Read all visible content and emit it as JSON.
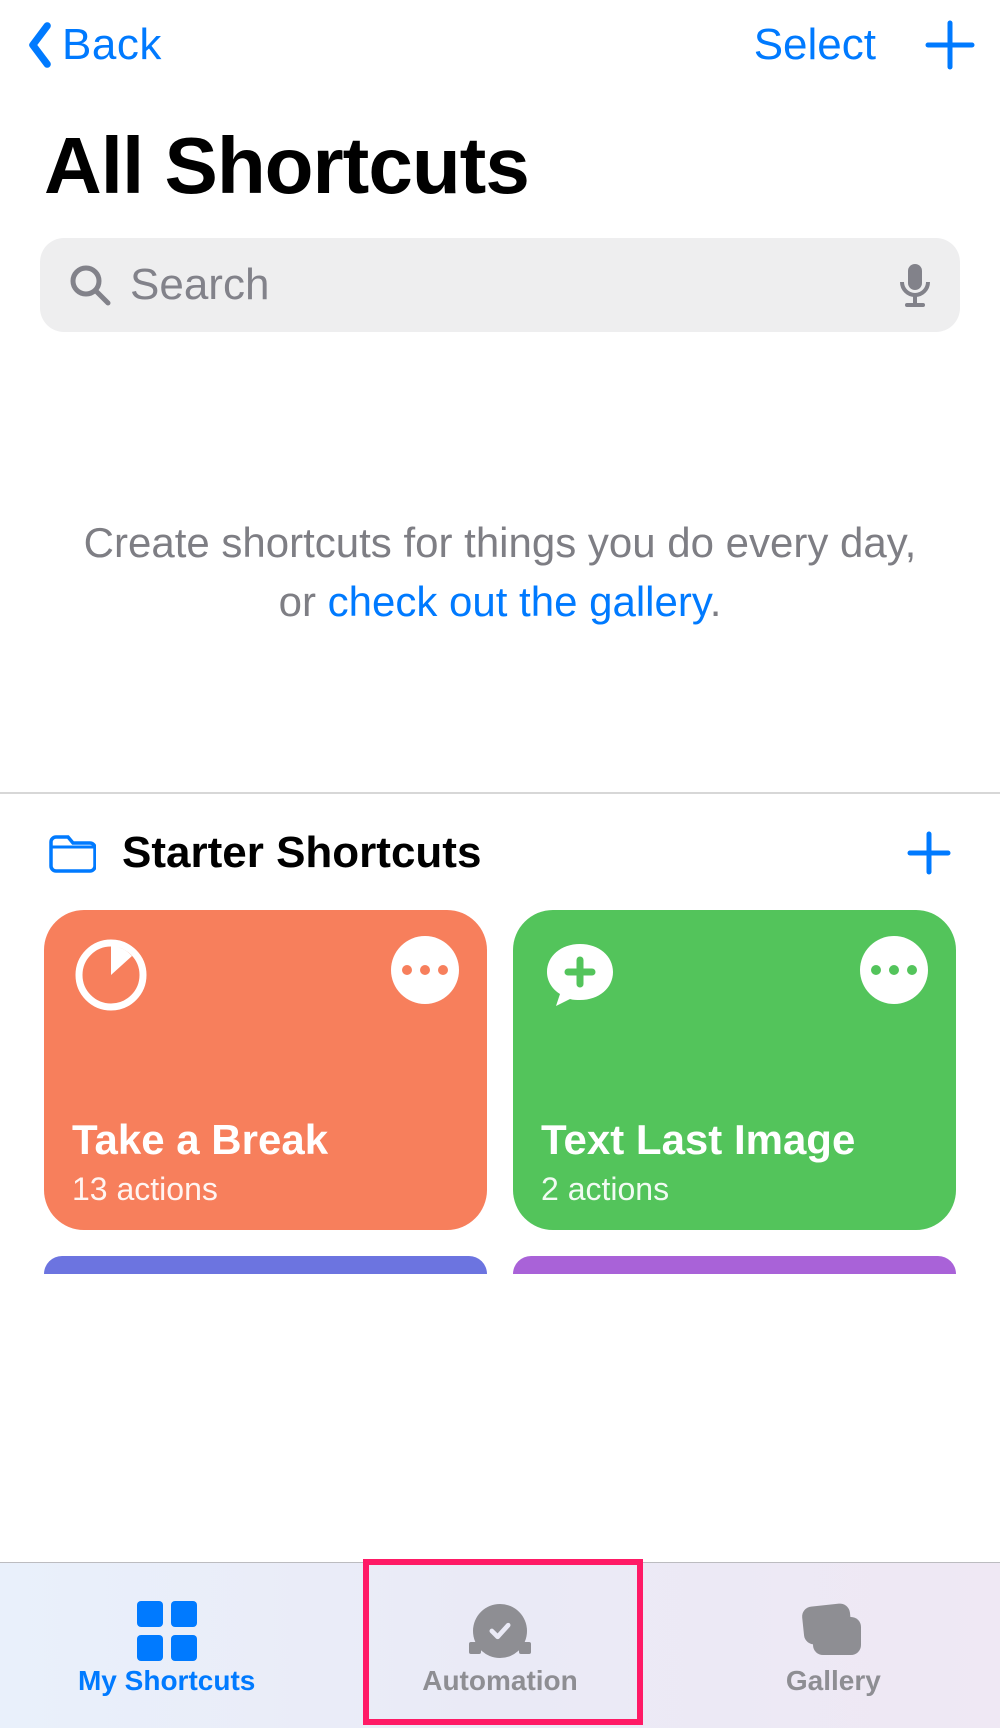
{
  "nav": {
    "back_label": "Back",
    "select_label": "Select"
  },
  "page_title": "All Shortcuts",
  "search": {
    "placeholder": "Search"
  },
  "empty": {
    "text_prefix": "Create shortcuts for things you do every day, or ",
    "link_text": "check out the gallery",
    "text_suffix": "."
  },
  "section": {
    "title": "Starter Shortcuts"
  },
  "tiles": [
    {
      "name": "Take a Break",
      "subtitle": "13 actions",
      "color": "orange",
      "icon": "timer"
    },
    {
      "name": "Text Last Image",
      "subtitle": "2 actions",
      "color": "green",
      "icon": "message-plus"
    }
  ],
  "tabs": {
    "shortcuts": "My Shortcuts",
    "automation": "Automation",
    "gallery": "Gallery",
    "active": "shortcuts",
    "highlighted": "automation"
  },
  "colors": {
    "accent": "#007aff",
    "orange": "#f77f5c",
    "green": "#53c45b",
    "highlight": "#ff1a66"
  }
}
